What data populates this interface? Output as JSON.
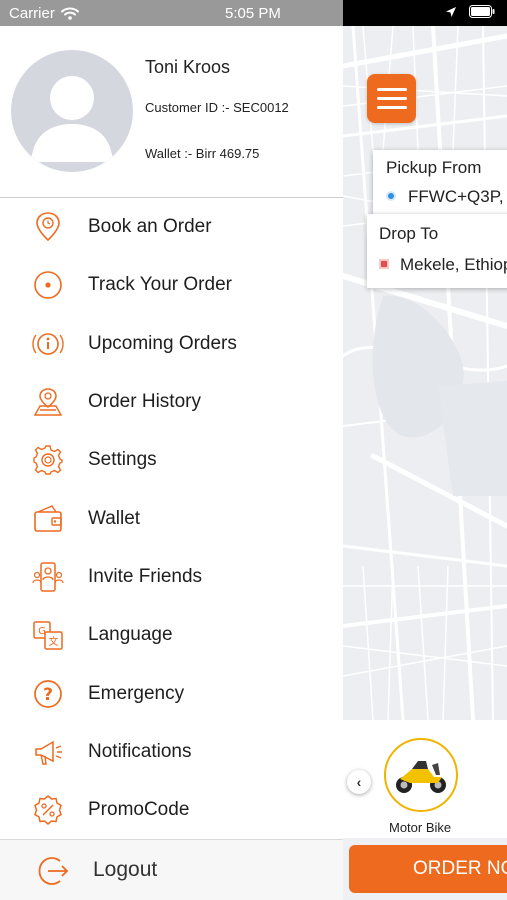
{
  "status_bar": {
    "carrier": "Carrier",
    "time": "5:05 PM"
  },
  "profile": {
    "name": "Toni Kroos",
    "customer_id": "Customer ID :- SEC0012",
    "wallet": "Wallet :- Birr 469.75"
  },
  "menu": {
    "items": [
      {
        "label": "Book an Order",
        "icon": "book-order-icon"
      },
      {
        "label": "Track Your Order",
        "icon": "track-order-icon"
      },
      {
        "label": "Upcoming Orders",
        "icon": "upcoming-orders-icon"
      },
      {
        "label": "Order History",
        "icon": "order-history-icon"
      },
      {
        "label": "Settings",
        "icon": "settings-icon"
      },
      {
        "label": "Wallet",
        "icon": "wallet-icon"
      },
      {
        "label": "Invite Friends",
        "icon": "invite-friends-icon"
      },
      {
        "label": "Language",
        "icon": "language-icon"
      },
      {
        "label": "Emergency",
        "icon": "emergency-icon"
      },
      {
        "label": "Notifications",
        "icon": "notifications-icon"
      },
      {
        "label": "PromoCode",
        "icon": "promo-code-icon"
      }
    ],
    "logout_label": "Logout"
  },
  "map": {
    "pickup_title": "Pickup From",
    "pickup_value": "FFWC+Q3P,",
    "drop_title": "Drop To",
    "drop_value": "Mekele, Ethiop"
  },
  "vehicle": {
    "label": "Motor Bike"
  },
  "order_button": "ORDER NO",
  "colors": {
    "accent": "#ee6a1f",
    "vehicle_ring": "#f0b400",
    "pickup_dot": "#2f8fe2",
    "drop_marker": "#e34c4c"
  }
}
